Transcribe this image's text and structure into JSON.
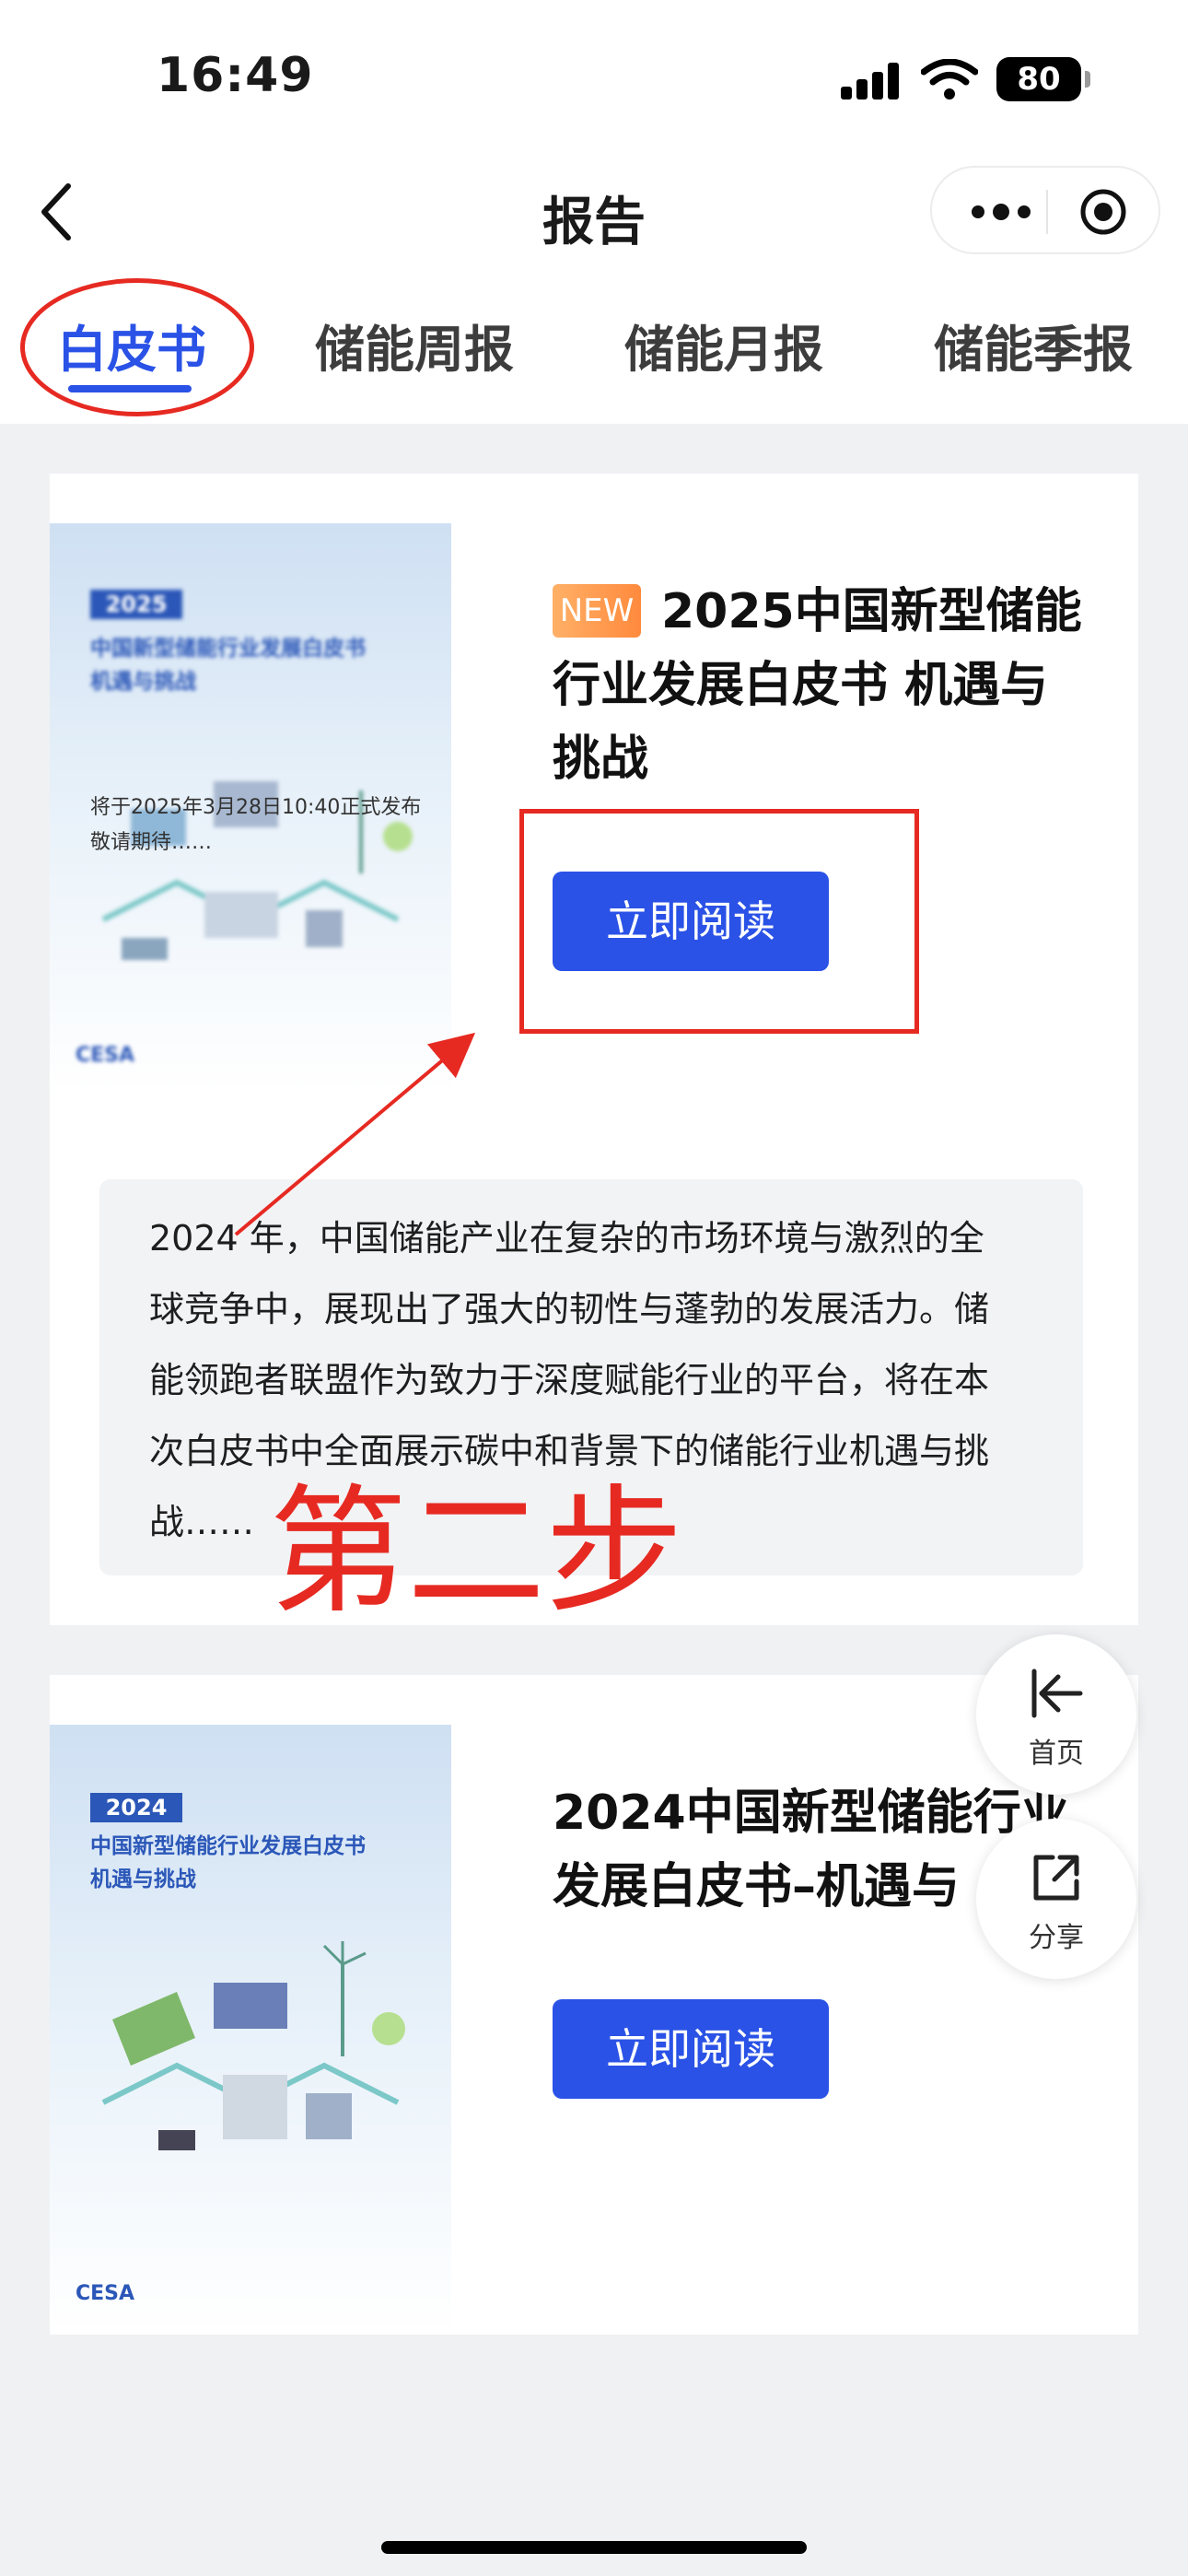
{
  "status_bar": {
    "time": "16:49",
    "battery": "80"
  },
  "nav": {
    "title": "报告"
  },
  "tabs": [
    {
      "label": "白皮书",
      "active": true
    },
    {
      "label": "储能周报",
      "active": false
    },
    {
      "label": "储能月报",
      "active": false
    },
    {
      "label": "储能季报",
      "active": false
    }
  ],
  "cards": [
    {
      "badge": "NEW",
      "title_lines": [
        "2025中国新型储能",
        "行业发展白皮书 机遇与",
        "挑战"
      ],
      "button": "立即阅读",
      "cover": {
        "year": "2025",
        "title_lines": [
          "中国新型储能行业发展白皮书",
          "机遇与挑战"
        ],
        "note_lines": [
          "将于2025年3月28日10:40正式发布",
          "敬请期待……"
        ],
        "logo": "CESA"
      },
      "description_lines": [
        "2024 年，中国储能产业在复杂的市场环境与激烈的全",
        "球竞争中，展现出了强大的韧性与蓬勃的发展活力。储",
        "能领跑者联盟作为致力于深度赋能行业的平台，将在本",
        "次白皮书中全面展示碳中和背景下的储能行业机遇与挑",
        "战……"
      ]
    },
    {
      "title_lines": [
        "2024中国新型储能行业",
        "发展白皮书–机遇与"
      ],
      "button": "立即阅读",
      "cover": {
        "year": "2024",
        "title_lines": [
          "中国新型储能行业发展白皮书",
          "机遇与挑战"
        ],
        "logo": "CESA"
      }
    }
  ],
  "annotation": {
    "label": "第二步"
  },
  "floating": {
    "home": "首页",
    "share": "分享"
  },
  "colors": {
    "accent": "#2a52e6",
    "annotation": "#e62a22",
    "badge": "#ff9a4d"
  }
}
